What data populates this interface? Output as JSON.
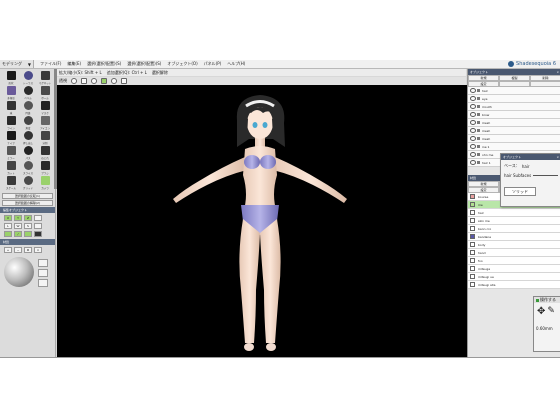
{
  "app": {
    "brand": "Shadesequoia 6"
  },
  "menubar": {
    "mode": "モデリング",
    "items": [
      "ファイル(F)",
      "編集(E)",
      "選択(選択/配置)(S)",
      "選択(選択/配置)(S)",
      "オブジェクト(O)",
      "パネル(P)",
      "ヘルプ(H)"
    ]
  },
  "toolbar": {
    "items": [
      "L: 選択",
      "拡大/縮小(S): Shift + L",
      "追加選択(Q): Ctrl + L",
      "選択解除"
    ]
  },
  "viewport": {
    "label": "透視"
  },
  "palette": {
    "tools": [
      "形状",
      "トーラス",
      "マグネット",
      "多角形",
      "ベベル",
      "ボール",
      "球",
      "円錐",
      "マスク",
      "ライン",
      "角度",
      "アイコン",
      "ナイフ",
      "押し出し",
      "分割",
      "ミラー",
      "パス",
      "ねじれ",
      "カット",
      "スライス",
      "ブラシ",
      "スケール",
      "グリッド",
      "カメラ"
    ],
    "buttons": [
      "選択範囲の反転(1)",
      "選択範囲の解除(2)"
    ],
    "section1": "編集オブジェクト",
    "mini": [
      "X",
      "Y",
      "Z",
      "S",
      "L",
      "W",
      "S",
      "",
      "",
      "",
      ""
    ],
    "section2": "材質"
  },
  "right": {
    "objects_title": "オブジェクト",
    "objects_tabs": [
      "新規",
      "複製",
      "削除"
    ],
    "objects_tabs2": [
      "設定",
      "",
      ""
    ],
    "objects": [
      "hair",
      "eye",
      "mouth",
      "brow",
      "mesh",
      "mesh",
      "mesh",
      "ine 1",
      "ohn me",
      "hair 1"
    ],
    "materials_title": "材質",
    "materials_tabs": [
      "新規",
      "複製",
      "削除"
    ],
    "materials_tabs2": [
      "設定",
      "",
      "他"
    ],
    "materials": [
      {
        "name": "bourse",
        "color": "#e8a0a0"
      },
      {
        "name": "me",
        "color": "#b0e090"
      },
      {
        "name": "hair",
        "color": "#ffffff"
      },
      {
        "name": "skin me",
        "color": "#ffffff"
      },
      {
        "name": "bann cro",
        "color": "#ffffff"
      },
      {
        "name": "bandane",
        "color": "#5a58a8"
      },
      {
        "name": "body",
        "color": "#ffffff"
      },
      {
        "name": "hand",
        "color": "#ffffff"
      },
      {
        "name": "foo",
        "color": "#ffffff"
      },
      {
        "name": "mitsuga",
        "color": "#ffffff"
      },
      {
        "name": "mitsugi ue",
        "color": "#ffffff"
      },
      {
        "name": "mitsugi sita",
        "color": "#ffffff"
      }
    ]
  },
  "popup": {
    "title": "オブジェクト",
    "label1": "ベース：",
    "val1": "hair",
    "label2": "hair Subfaces",
    "button": "ソリッド"
  },
  "popup2": {
    "title": "操作する",
    "val": "0.60mm"
  },
  "colors": {
    "selected": "#b9e6a8",
    "header": "#4a5870"
  }
}
